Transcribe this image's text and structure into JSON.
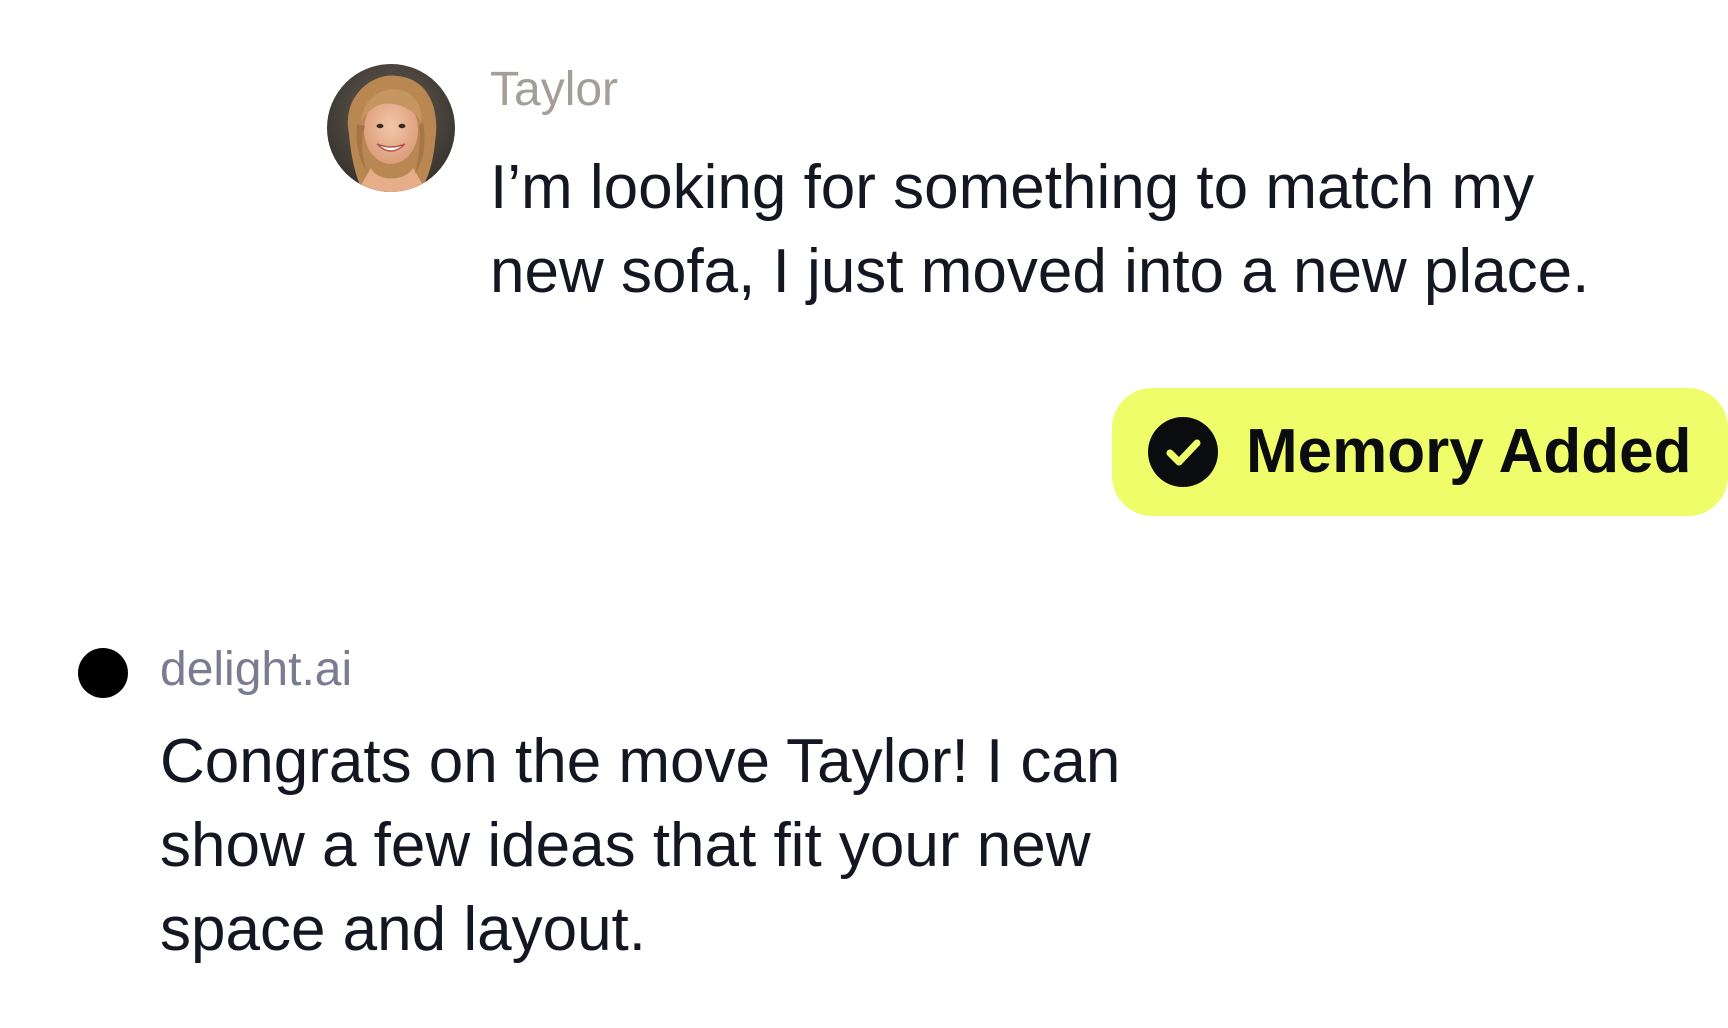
{
  "user_message": {
    "author": "Taylor",
    "text": "I’m looking for something to match my new sofa, I just moved into a new place.",
    "avatar_icon": "user-portrait-photo"
  },
  "memory_badge": {
    "label": "Memory Added",
    "icon": "check-circle-icon",
    "background_color": "#eefd69"
  },
  "bot_message": {
    "author": "delight.ai",
    "text": "Congrats on the move Taylor! I can show a few ideas that fit your new space and layout.",
    "icon": "black-dot"
  }
}
